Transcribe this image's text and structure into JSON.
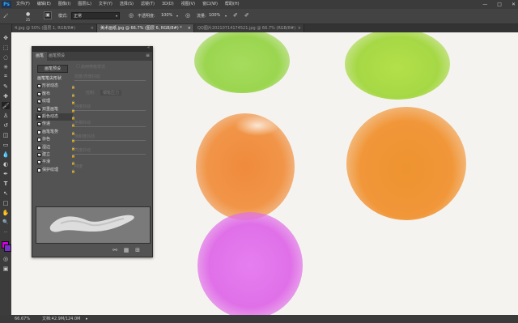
{
  "app": {
    "logo": "Ps"
  },
  "menu": [
    "文件(F)",
    "编辑(E)",
    "图像(I)",
    "图层(L)",
    "文字(Y)",
    "选择(S)",
    "滤镜(T)",
    "3D(D)",
    "视图(V)",
    "窗口(W)",
    "帮助(H)"
  ],
  "window_controls": {
    "minimize": "—",
    "maximize": "□",
    "close": "✕"
  },
  "options": {
    "brush_size": "25",
    "mode_label": "模式:",
    "mode_value": "正常",
    "opacity_label": "不透明度:",
    "opacity_value": "100%",
    "flow_label": "流量:",
    "flow_value": "100%"
  },
  "tabs": [
    {
      "label": "4.jpg @ 50% (图层 1, RGB/8#)",
      "active": false
    },
    {
      "label": "美术画纸.jpg @ 66.7% (图层 6, RGB/8#) *",
      "active": true
    },
    {
      "label": "QQ图片20210714174521.jpg @ 66.7% (RGB/8#)",
      "active": false
    }
  ],
  "tab_close": "×",
  "tools": [
    "move-icon",
    "marquee-icon",
    "lasso-icon",
    "magic-wand-icon",
    "crop-icon",
    "eyedropper-icon",
    "healing-icon",
    "brush-icon",
    "clone-stamp-icon",
    "history-brush-icon",
    "eraser-icon",
    "gradient-icon",
    "blur-icon",
    "dodge-icon",
    "pen-icon",
    "type-icon",
    "path-select-icon",
    "shape-icon",
    "hand-icon",
    "zoom-icon",
    "more-icon",
    "colors-icon",
    "quickmask-icon",
    "screen-mode-icon"
  ],
  "tool_glyphs": [
    "✥",
    "⬚",
    "◌",
    "✳",
    "⌗",
    "✎",
    "✚",
    "🖌",
    "♙",
    "↺",
    "◫",
    "▭",
    "💧",
    "◐",
    "✒",
    "T",
    "↖",
    "□",
    "✋",
    "🔍",
    "···",
    "■",
    "◎",
    "▣"
  ],
  "colors": {
    "foreground": "#d100e0",
    "background": "#7a30c8",
    "accent": "#31a8ff"
  },
  "brush_panel": {
    "tabs": [
      {
        "label": "画笔",
        "active": true
      },
      {
        "label": "画笔预设",
        "active": false
      }
    ],
    "preset_button": "画笔预设",
    "right_options": {
      "checkbox_label": "启用喷枪样式",
      "spacing_label": "控制:",
      "spacing_value": "钢笔压力",
      "rows": [
        "前景/背景抖动",
        "控制:",
        "纯度抖动",
        "色相抖动",
        "饱和度抖动",
        "亮度抖动",
        "纯度"
      ]
    },
    "items": [
      {
        "label": "画笔笔尖形状",
        "checked": false,
        "head": true,
        "sel": false
      },
      {
        "label": "形状动态",
        "checked": true,
        "head": false,
        "sel": false
      },
      {
        "label": "散布",
        "checked": true,
        "head": false,
        "sel": false
      },
      {
        "label": "纹理",
        "checked": true,
        "head": false,
        "sel": false
      },
      {
        "label": "双重画笔",
        "checked": true,
        "head": false,
        "sel": false
      },
      {
        "label": "颜色动态",
        "checked": true,
        "head": false,
        "sel": true
      },
      {
        "label": "传递",
        "checked": true,
        "head": false,
        "sel": false
      },
      {
        "label": "画笔笔势",
        "checked": false,
        "head": false,
        "sel": false
      },
      {
        "label": "杂色",
        "checked": false,
        "head": false,
        "sel": false
      },
      {
        "label": "湿边",
        "checked": false,
        "head": false,
        "sel": false
      },
      {
        "label": "建立",
        "checked": true,
        "head": false,
        "sel": false
      },
      {
        "label": "平滑",
        "checked": true,
        "head": false,
        "sel": false
      },
      {
        "label": "保护纹理",
        "checked": false,
        "head": false,
        "sel": false
      }
    ]
  },
  "canvas_blobs": [
    {
      "name": "green-blob-1",
      "color": "#9bd650"
    },
    {
      "name": "green-blob-2",
      "color": "#a6d845"
    },
    {
      "name": "orange-blob-1",
      "color": "#f09040"
    },
    {
      "name": "orange-blob-2",
      "color": "#f1973a"
    },
    {
      "name": "magenta-blob",
      "color": "#e070e8"
    }
  ],
  "status": {
    "zoom": "66.67%",
    "doc": "文档:42.9M/124.0M"
  }
}
